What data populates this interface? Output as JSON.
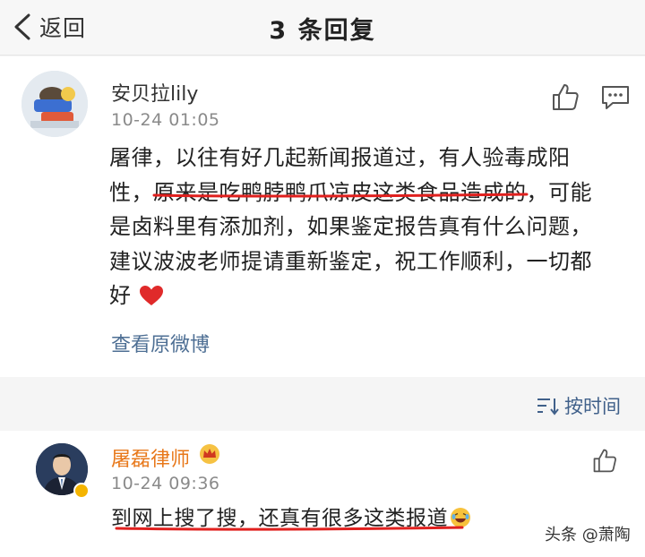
{
  "header": {
    "back_label": "返回",
    "title": "3 条回复"
  },
  "post": {
    "username": "安贝拉lily",
    "time": "10-24 01:05",
    "body_lines": [
      "屠律，以往有好几起新闻报道过，有人验毒成阳",
      "性，原来是吃鸭脖鸭爪凉皮这类食品造成的，可能",
      "是卤料里有添加剂，如果鉴定报告真有什么问题，",
      "建议波波老师提请重新鉴定，祝工作顺利，一切都",
      "好"
    ],
    "view_original": "查看原微博"
  },
  "sort": {
    "label": "按时间"
  },
  "reply": {
    "username": "屠磊律师",
    "time": "10-24 09:36",
    "text": "到网上搜了搜，还真有很多这类报道"
  },
  "watermark": "头条 @萧陶",
  "colors": {
    "link": "#4e6f94",
    "vip_name": "#e8781a",
    "underline": "#e0201e"
  }
}
